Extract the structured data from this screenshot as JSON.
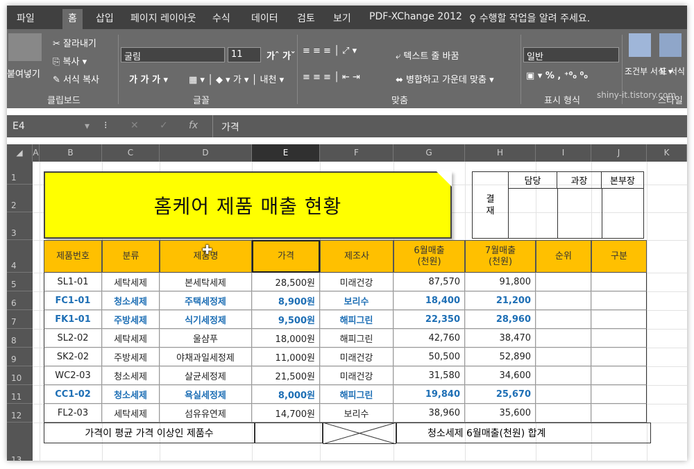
{
  "tabs": [
    "파일",
    "홈",
    "삽입",
    "페이지 레이아웃",
    "수식",
    "데이터",
    "검토",
    "보기",
    "PDF-XChange 2012",
    "♀ 수행할 작업을 알려 주세요."
  ],
  "ribbon": {
    "paste": "붙여넣기",
    "cut": "잘라내기",
    "copy": "복사 ▾",
    "format_painter": "서식 복사",
    "clipboard": "클립보드",
    "font_name": "굴림",
    "font_size": "11",
    "font_buttons": "가 가 가 ▾",
    "font_group": "글꼴",
    "wrap_text": "텍스트 줄 바꿈",
    "merge_center": "병합하고 가운데 맞춤 ▾",
    "align_group": "맞춤",
    "number_format": "일반",
    "number_group": "표시 형식",
    "cond_format": "조건부 서식 ▾",
    "table_format": "표 서식 ▾",
    "style_group": "스타일",
    "watermark": "shiny-it.tistory.com"
  },
  "formula_bar": {
    "cell_ref": "E4",
    "fx": "fx",
    "value": "가격"
  },
  "columns": [
    "A",
    "B",
    "C",
    "D",
    "E",
    "F",
    "G",
    "H",
    "I",
    "J",
    "K"
  ],
  "rows": [
    "1",
    "2",
    "3",
    "4",
    "5",
    "6",
    "7",
    "8",
    "9",
    "10",
    "11",
    "12",
    "13"
  ],
  "title": "홈케어 제품 매출 현황",
  "approval": {
    "label": "결\n재",
    "heads": [
      "담당",
      "과장",
      "본부장"
    ]
  },
  "headers": [
    "제품번호",
    "분류",
    "제품명",
    "가격",
    "제조사",
    "6월매출\n(천원)",
    "7월매출\n(천원)",
    "순위",
    "구분"
  ],
  "data": [
    [
      "SL1-01",
      "세탁세제",
      "본세탁세제",
      "28,500원",
      "미래건강",
      "87,570",
      "91,800"
    ],
    [
      "FC1-01",
      "청소세제",
      "주택세정제",
      "8,900원",
      "보리수",
      "18,400",
      "21,200"
    ],
    [
      "FK1-01",
      "주방세제",
      "식기세정제",
      "9,500원",
      "해피그린",
      "22,350",
      "28,960"
    ],
    [
      "SL2-02",
      "세탁세제",
      "울샴푸",
      "18,000원",
      "해피그린",
      "42,760",
      "38,470"
    ],
    [
      "SK2-02",
      "주방세제",
      "야채과일세정제",
      "11,000원",
      "미래건강",
      "50,500",
      "52,890"
    ],
    [
      "WC2-03",
      "청소세제",
      "살균세정제",
      "21,500원",
      "미래건강",
      "31,580",
      "34,600"
    ],
    [
      "CC1-02",
      "청소세제",
      "욕실세정제",
      "8,000원",
      "해피그린",
      "19,840",
      "25,670"
    ],
    [
      "FL2-03",
      "세탁세제",
      "섬유유연제",
      "14,700원",
      "보리수",
      "38,960",
      "35,600"
    ]
  ],
  "highlight_rows": [
    1,
    2,
    6
  ],
  "footer": {
    "left": "가격이 평균 가격 이상인 제품수",
    "right": "청소세제 6월매출(천원) 합계"
  }
}
